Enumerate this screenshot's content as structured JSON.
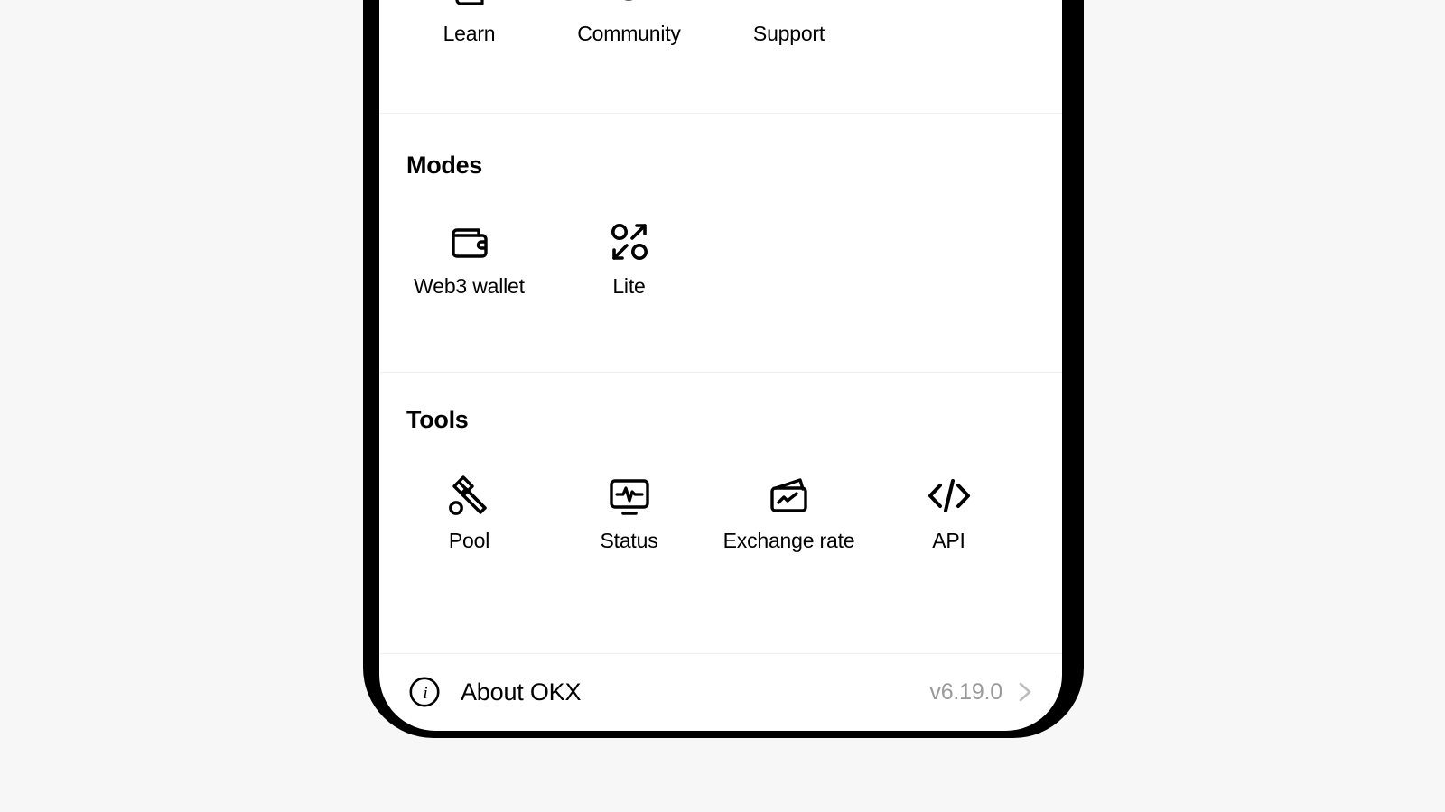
{
  "app": {
    "name": "OKX",
    "background_color": "#f7f7f7",
    "screen_color": "#ffffff",
    "frame_color": "#000000",
    "divider_color": "#f0f0f0",
    "muted_text_color": "#9a9a9a"
  },
  "top_section": {
    "items": [
      {
        "label": "Learn",
        "icon": "book-icon"
      },
      {
        "label": "Community",
        "icon": "globe-icon"
      },
      {
        "label": "Support",
        "icon": "headset-icon"
      }
    ]
  },
  "modes_section": {
    "title": "Modes",
    "items": [
      {
        "label": "Web3 wallet",
        "icon": "wallet-icon"
      },
      {
        "label": "Lite",
        "icon": "okx-lite-icon"
      }
    ]
  },
  "tools_section": {
    "title": "Tools",
    "items": [
      {
        "label": "Pool",
        "icon": "hammer-icon"
      },
      {
        "label": "Status",
        "icon": "monitor-pulse-icon"
      },
      {
        "label": "Exchange rate",
        "icon": "rate-card-icon"
      },
      {
        "label": "API",
        "icon": "code-brackets-icon"
      }
    ]
  },
  "about_row": {
    "label": "About OKX",
    "version": "v6.19.0",
    "info_icon": "info-circle-icon",
    "chevron_icon": "chevron-right-icon"
  }
}
